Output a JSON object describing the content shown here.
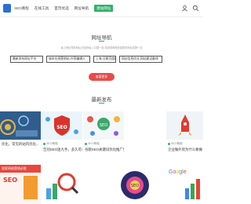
{
  "header": {
    "nav": [
      "SEO教程",
      "在线工具",
      "首页优选",
      "网址导航",
      "建站网址"
    ],
    "active_index": 4
  },
  "hero": {
    "title": "网址导航",
    "subtitle": "最上网址导航网址,在线网址入口整一处,常用常网络资源更多网址站群一站",
    "tags": [
      "最新发布网址平台",
      "城市在线营销站-外贸编辑入",
      "上海-谷歌百度框-上海推门",
      "网站信息优化,网站建设备线"
    ],
    "button": "查看更多"
  },
  "section": {
    "title": "最新发布"
  },
  "cards": [
    {
      "meta": "",
      "title": "优化，常见的站内优化..."
    },
    {
      "meta": "SEO教程",
      "title": "告别SEO迷九手，多久可以入门"
    },
    {
      "meta": "SEO教程",
      "title": "谷歌SEO关键词优化推广免每个网站..."
    },
    {
      "meta": "SEO教程",
      "title": "企业做外贸为什么要做"
    }
  ],
  "row2": [
    {
      "label": "搜索网络营销必胜"
    },
    {
      "label": ""
    },
    {
      "label": ""
    },
    {
      "label": "Google"
    }
  ]
}
